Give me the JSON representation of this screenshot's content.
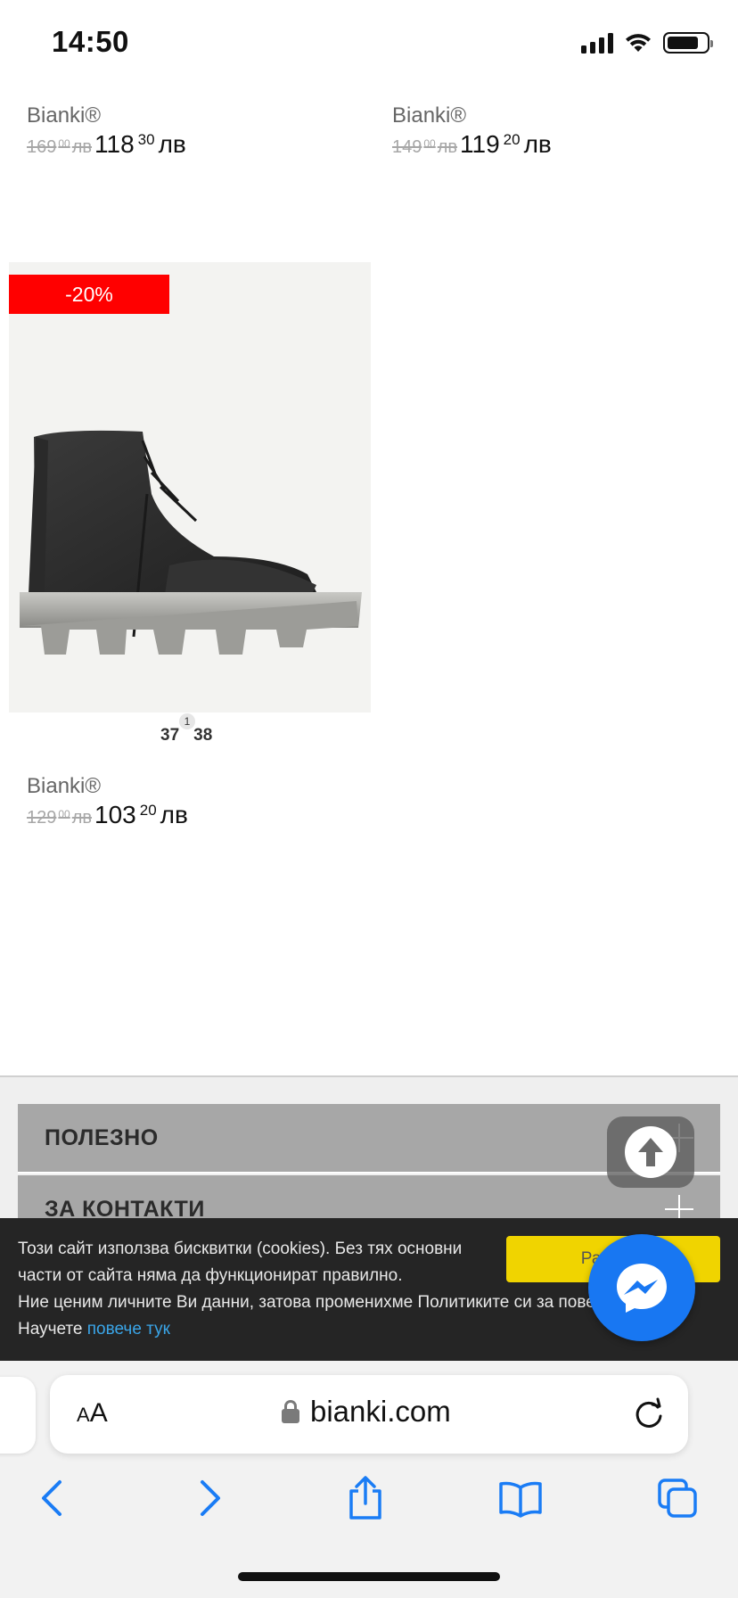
{
  "status_bar": {
    "time": "14:50"
  },
  "products": [
    {
      "brand": "Bianki®",
      "old_price_main": "169",
      "old_price_cents": "00",
      "old_currency": "лв",
      "new_price_main": "118",
      "new_price_cents": "30",
      "new_currency": "лв"
    },
    {
      "brand": "Bianki®",
      "old_price_main": "149",
      "old_price_cents": "00",
      "old_currency": "лв",
      "new_price_main": "119",
      "new_price_cents": "20",
      "new_currency": "лв"
    },
    {
      "brand": "Bianki®",
      "discount": "-20%",
      "sizes": [
        "37",
        "38"
      ],
      "size_37_count": "1",
      "old_price_main": "129",
      "old_price_cents": "00",
      "old_currency": "лв",
      "new_price_main": "103",
      "new_price_cents": "20",
      "new_currency": "лв"
    }
  ],
  "footer": {
    "sections": [
      {
        "title": "ПОЛЕЗНО"
      },
      {
        "title": "ЗА КОНТАКТИ"
      }
    ]
  },
  "cookie_bar": {
    "line1": "Този сайт използва бисквитки (cookies). Без тях основни",
    "line2": "части от сайта няма да функционират правилно.",
    "line3": "Ние ценим личните Ви данни, затова променихме Политиките си за поверителност.",
    "line4_prefix": "Научете ",
    "link_text": "повече тук",
    "accept_label": "Разбрах"
  },
  "browser": {
    "aa_small": "A",
    "aa_large": "A",
    "url": "bianki.com"
  },
  "colors": {
    "discount_badge": "#ff0000",
    "accept_button": "#f0d400",
    "messenger": "#1877f2",
    "link": "#3aa5e8",
    "ios_blue": "#1a7cf5"
  },
  "icons": [
    "signal-icon",
    "wifi-icon",
    "battery-icon",
    "arrow-up-icon",
    "messenger-icon",
    "lock-icon",
    "reload-icon",
    "back-icon",
    "forward-icon",
    "share-icon",
    "bookmarks-icon",
    "tabs-icon"
  ]
}
